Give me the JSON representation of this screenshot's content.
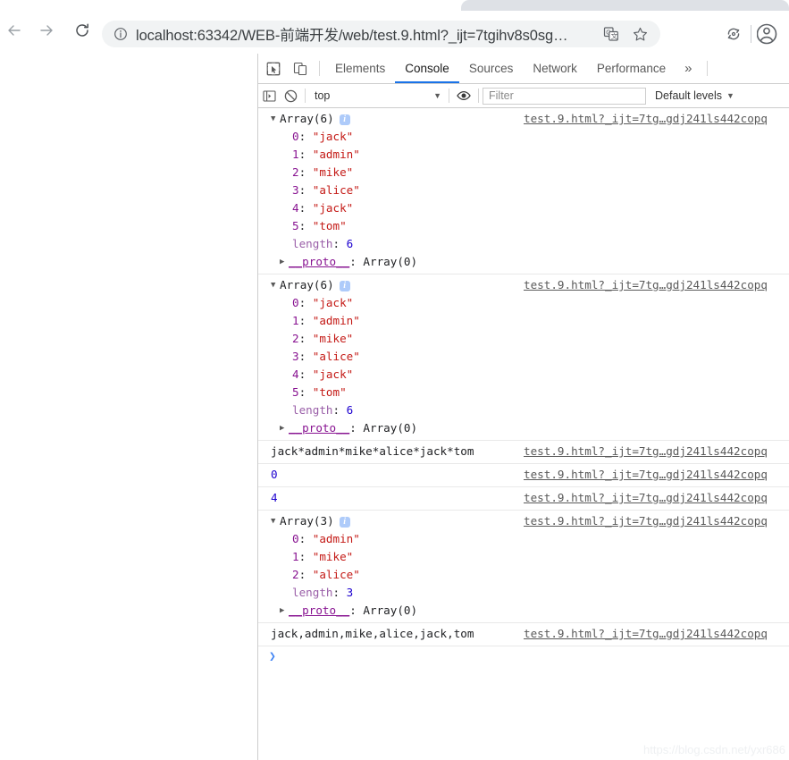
{
  "browser": {
    "nav": {
      "back_label": "Back",
      "forward_label": "Forward",
      "reload_label": "Reload"
    },
    "omnibox": {
      "url": "localhost:63342/WEB-前端开发/web/test.9.html?_ijt=7tgihv8s0sg…",
      "info_icon": "page-info-icon",
      "translate_icon": "translate-icon",
      "bookmark_icon": "star-icon"
    },
    "toolbar_right": {
      "sync_icon": "sync-refresh-icon",
      "avatar_icon": "profile-avatar-icon"
    }
  },
  "devtools": {
    "inspect_icon": "inspect-element-icon",
    "device_icon": "device-toolbar-icon",
    "tabs": [
      {
        "label": "Elements",
        "active": false
      },
      {
        "label": "Console",
        "active": true
      },
      {
        "label": "Sources",
        "active": false
      },
      {
        "label": "Network",
        "active": false
      },
      {
        "label": "Performance",
        "active": false
      }
    ],
    "more_tabs_label": "»",
    "console_toolbar": {
      "sidebar_icon": "console-sidebar-icon",
      "clear_icon": "clear-console-icon",
      "context_value": "top",
      "eye_icon": "live-expression-icon",
      "filter_value": "",
      "filter_placeholder": "Filter",
      "levels_label": "Default levels",
      "caret": "▼"
    },
    "source_link": "test.9.html?_ijt=7tg…gdj241ls442copq",
    "messages": [
      {
        "kind": "object",
        "header": "Array(6)",
        "badge": "i",
        "props": [
          {
            "key": "0",
            "keyType": "index",
            "value": "\"jack\"",
            "valueType": "string"
          },
          {
            "key": "1",
            "keyType": "index",
            "value": "\"admin\"",
            "valueType": "string"
          },
          {
            "key": "2",
            "keyType": "index",
            "value": "\"mike\"",
            "valueType": "string"
          },
          {
            "key": "3",
            "keyType": "index",
            "value": "\"alice\"",
            "valueType": "string"
          },
          {
            "key": "4",
            "keyType": "index",
            "value": "\"jack\"",
            "valueType": "string"
          },
          {
            "key": "5",
            "keyType": "index",
            "value": "\"tom\"",
            "valueType": "string"
          },
          {
            "key": "length",
            "keyType": "length",
            "value": "6",
            "valueType": "number"
          }
        ],
        "proto": {
          "key": "__proto__",
          "value": "Array(0)"
        }
      },
      {
        "kind": "object",
        "header": "Array(6)",
        "badge": "i",
        "props": [
          {
            "key": "0",
            "keyType": "index",
            "value": "\"jack\"",
            "valueType": "string"
          },
          {
            "key": "1",
            "keyType": "index",
            "value": "\"admin\"",
            "valueType": "string"
          },
          {
            "key": "2",
            "keyType": "index",
            "value": "\"mike\"",
            "valueType": "string"
          },
          {
            "key": "3",
            "keyType": "index",
            "value": "\"alice\"",
            "valueType": "string"
          },
          {
            "key": "4",
            "keyType": "index",
            "value": "\"jack\"",
            "valueType": "string"
          },
          {
            "key": "5",
            "keyType": "index",
            "value": "\"tom\"",
            "valueType": "string"
          },
          {
            "key": "length",
            "keyType": "length",
            "value": "6",
            "valueType": "number"
          }
        ],
        "proto": {
          "key": "__proto__",
          "value": "Array(0)"
        }
      },
      {
        "kind": "text",
        "text": "jack*admin*mike*alice*jack*tom"
      },
      {
        "kind": "number",
        "text": "0"
      },
      {
        "kind": "number",
        "text": "4"
      },
      {
        "kind": "object",
        "header": "Array(3)",
        "badge": "i",
        "props": [
          {
            "key": "0",
            "keyType": "index",
            "value": "\"admin\"",
            "valueType": "string"
          },
          {
            "key": "1",
            "keyType": "index",
            "value": "\"mike\"",
            "valueType": "string"
          },
          {
            "key": "2",
            "keyType": "index",
            "value": "\"alice\"",
            "valueType": "string"
          },
          {
            "key": "length",
            "keyType": "length",
            "value": "3",
            "valueType": "number"
          }
        ],
        "proto": {
          "key": "__proto__",
          "value": "Array(0)"
        }
      },
      {
        "kind": "text",
        "text": "jack,admin,mike,alice,jack,tom"
      }
    ],
    "prompt_caret": "❯"
  },
  "watermark": "https://blog.csdn.net/yxr686",
  "colors": {
    "accent": "#1a73e8",
    "string": "#c41a16",
    "number": "#1c00cf",
    "key": "#881391",
    "badge": "#aecbfa",
    "chrome_bg": "#dee1e6",
    "omnibox_bg": "#f1f3f4"
  }
}
